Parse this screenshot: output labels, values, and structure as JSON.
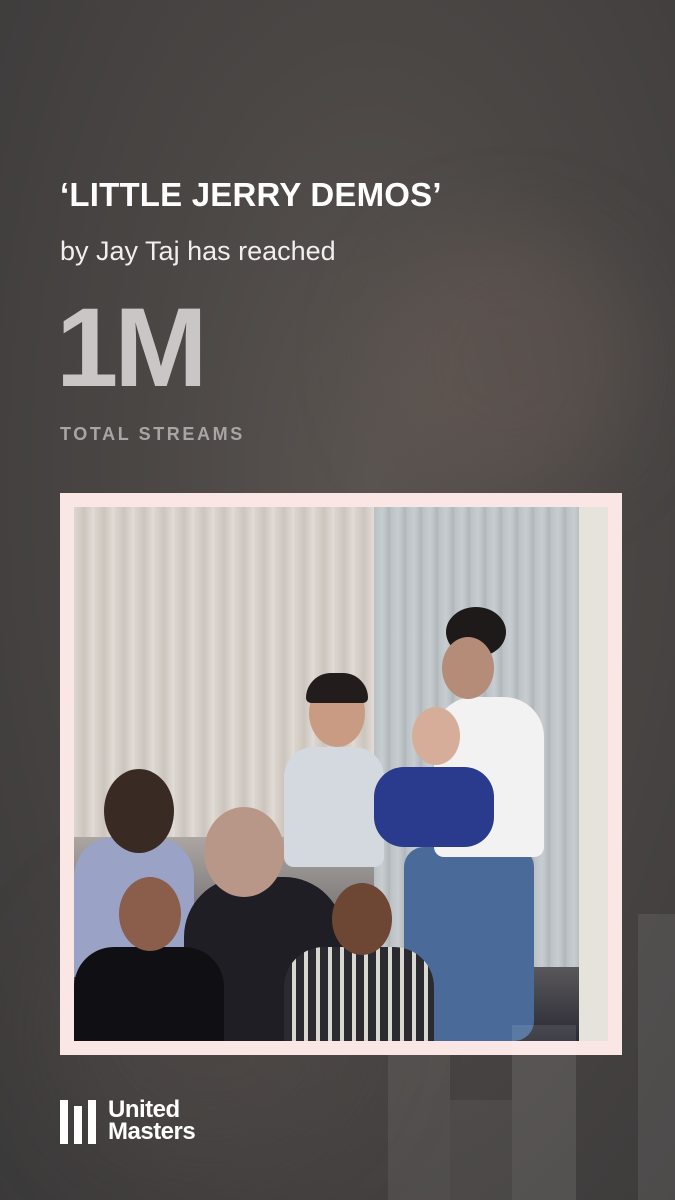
{
  "story": {
    "title": "‘LITTLE JERRY DEMOS’",
    "subtitle": "by Jay Taj has reached",
    "milestone": "1M",
    "milestone_caption": "TOTAL STREAMS"
  },
  "brand": {
    "name_line1": "United",
    "name_line2": "Masters"
  },
  "colors": {
    "frame": "#fbe6e6",
    "milestone": "#c9c6c5",
    "caption": "#a8a5a4"
  }
}
